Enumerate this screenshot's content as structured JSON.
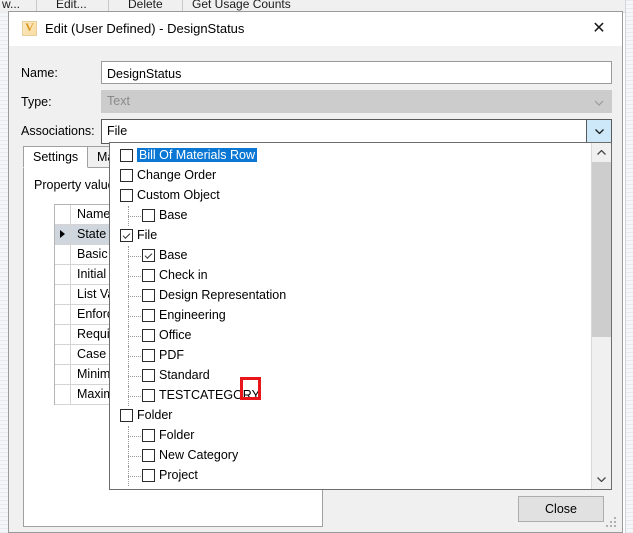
{
  "background": {
    "toolbar_items": [
      "w...",
      "Edit...",
      "Delete",
      "Get Usage Counts"
    ],
    "delete_icon": "x-icon",
    "edit_icon": "edit-icon"
  },
  "dialog": {
    "title": "Edit (User Defined) - DesignStatus",
    "app_icon": "V",
    "close_icon": "✕",
    "fields": {
      "name_label": "Name:",
      "name_value": "DesignStatus",
      "type_label": "Type:",
      "type_value": "Text",
      "assoc_label": "Associations:",
      "assoc_value": "File"
    },
    "tabs": [
      {
        "label": "Settings",
        "active": true
      },
      {
        "label": "Map",
        "active": false
      }
    ],
    "property_caption": "Property value",
    "property_rows": [
      {
        "label": "Name",
        "selected": false
      },
      {
        "label": "State",
        "selected": true
      },
      {
        "label": "Basic Search",
        "selected": false
      },
      {
        "label": "Initial Value",
        "selected": false
      },
      {
        "label": "List Values",
        "selected": false
      },
      {
        "label": "Enforce List",
        "selected": false
      },
      {
        "label": "Requires Value",
        "selected": false
      },
      {
        "label": "Case Sensitive",
        "selected": false
      },
      {
        "label": "Minimum",
        "selected": false
      },
      {
        "label": "Maximum",
        "selected": false
      }
    ],
    "close_button": "Close"
  },
  "dropdown": {
    "items": [
      {
        "label": "Bill Of Materials Row",
        "level": 0,
        "checked": false,
        "selected": true
      },
      {
        "label": "Change Order",
        "level": 0,
        "checked": false,
        "selected": false
      },
      {
        "label": "Custom Object",
        "level": 0,
        "checked": false,
        "selected": false
      },
      {
        "label": "Base",
        "level": 1,
        "checked": false,
        "selected": false
      },
      {
        "label": "File",
        "level": 0,
        "checked": true,
        "selected": false
      },
      {
        "label": "Base",
        "level": 1,
        "checked": true,
        "selected": false,
        "highlighted": true
      },
      {
        "label": "Check in",
        "level": 1,
        "checked": false,
        "selected": false
      },
      {
        "label": "Design Representation",
        "level": 1,
        "checked": false,
        "selected": false
      },
      {
        "label": "Engineering",
        "level": 1,
        "checked": false,
        "selected": false
      },
      {
        "label": "Office",
        "level": 1,
        "checked": false,
        "selected": false
      },
      {
        "label": "PDF",
        "level": 1,
        "checked": false,
        "selected": false
      },
      {
        "label": "Standard",
        "level": 1,
        "checked": false,
        "selected": false
      },
      {
        "label": "TESTCATEGORY",
        "level": 1,
        "checked": false,
        "selected": false
      },
      {
        "label": "Folder",
        "level": 0,
        "checked": false,
        "selected": false
      },
      {
        "label": "Folder",
        "level": 1,
        "checked": false,
        "selected": false
      },
      {
        "label": "New Category",
        "level": 1,
        "checked": false,
        "selected": false
      },
      {
        "label": "Project",
        "level": 1,
        "checked": false,
        "selected": false
      }
    ],
    "scroll_up_icon": "chevron-up-icon",
    "scroll_down_icon": "chevron-down-icon"
  },
  "colors": {
    "selection_blue": "#0b77d4",
    "annotation_red": "#e8161a",
    "combo_button_blue": "#cde8f8",
    "dialog_bg": "#f0f0f0",
    "disabled_bg": "#cccccc"
  }
}
